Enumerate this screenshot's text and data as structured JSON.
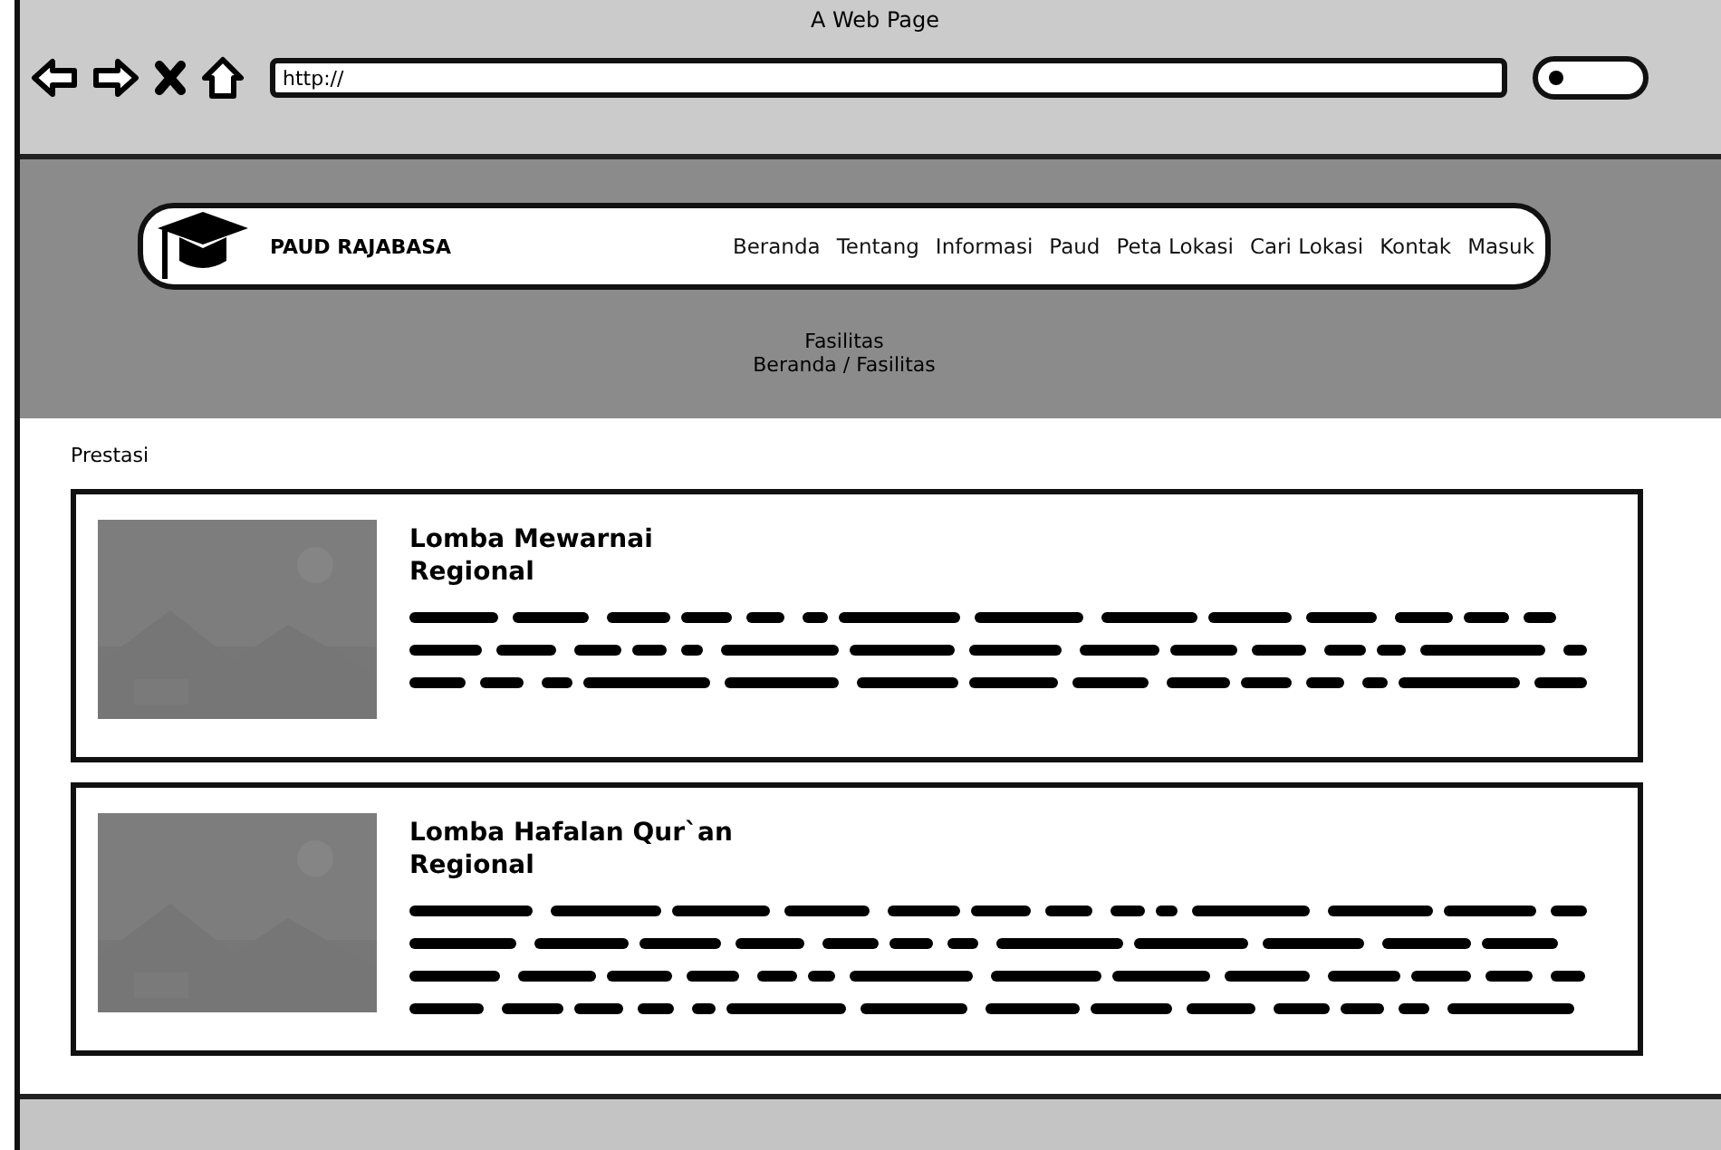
{
  "window": {
    "title": "A Web Page"
  },
  "address_bar": {
    "value": "http://"
  },
  "navbar": {
    "brand": "PAUD RAJABASA",
    "items": [
      "Beranda",
      "Tentang",
      "Informasi",
      "Paud",
      "Peta Lokasi",
      "Cari Lokasi",
      "Kontak",
      "Masuk"
    ]
  },
  "page_header": {
    "title": "Fasilitas",
    "breadcrumb": "Beranda / Fasilitas"
  },
  "section": {
    "title": "Prestasi"
  },
  "cards": [
    {
      "title": "Lomba Mewarnai",
      "subtitle": "Regional",
      "image": {
        "kind": "picture"
      },
      "body_lines": [
        {
          "kind": "scribble"
        },
        {
          "kind": "scribble"
        },
        {
          "kind": "scribble"
        }
      ]
    },
    {
      "title": "Lomba Hafalan Qur`an",
      "subtitle": "Regional",
      "image": {
        "kind": "picture"
      },
      "body_lines": [
        {
          "kind": "scribble"
        },
        {
          "kind": "scribble"
        },
        {
          "kind": "scribble"
        },
        {
          "kind": "scribble"
        }
      ]
    }
  ]
}
